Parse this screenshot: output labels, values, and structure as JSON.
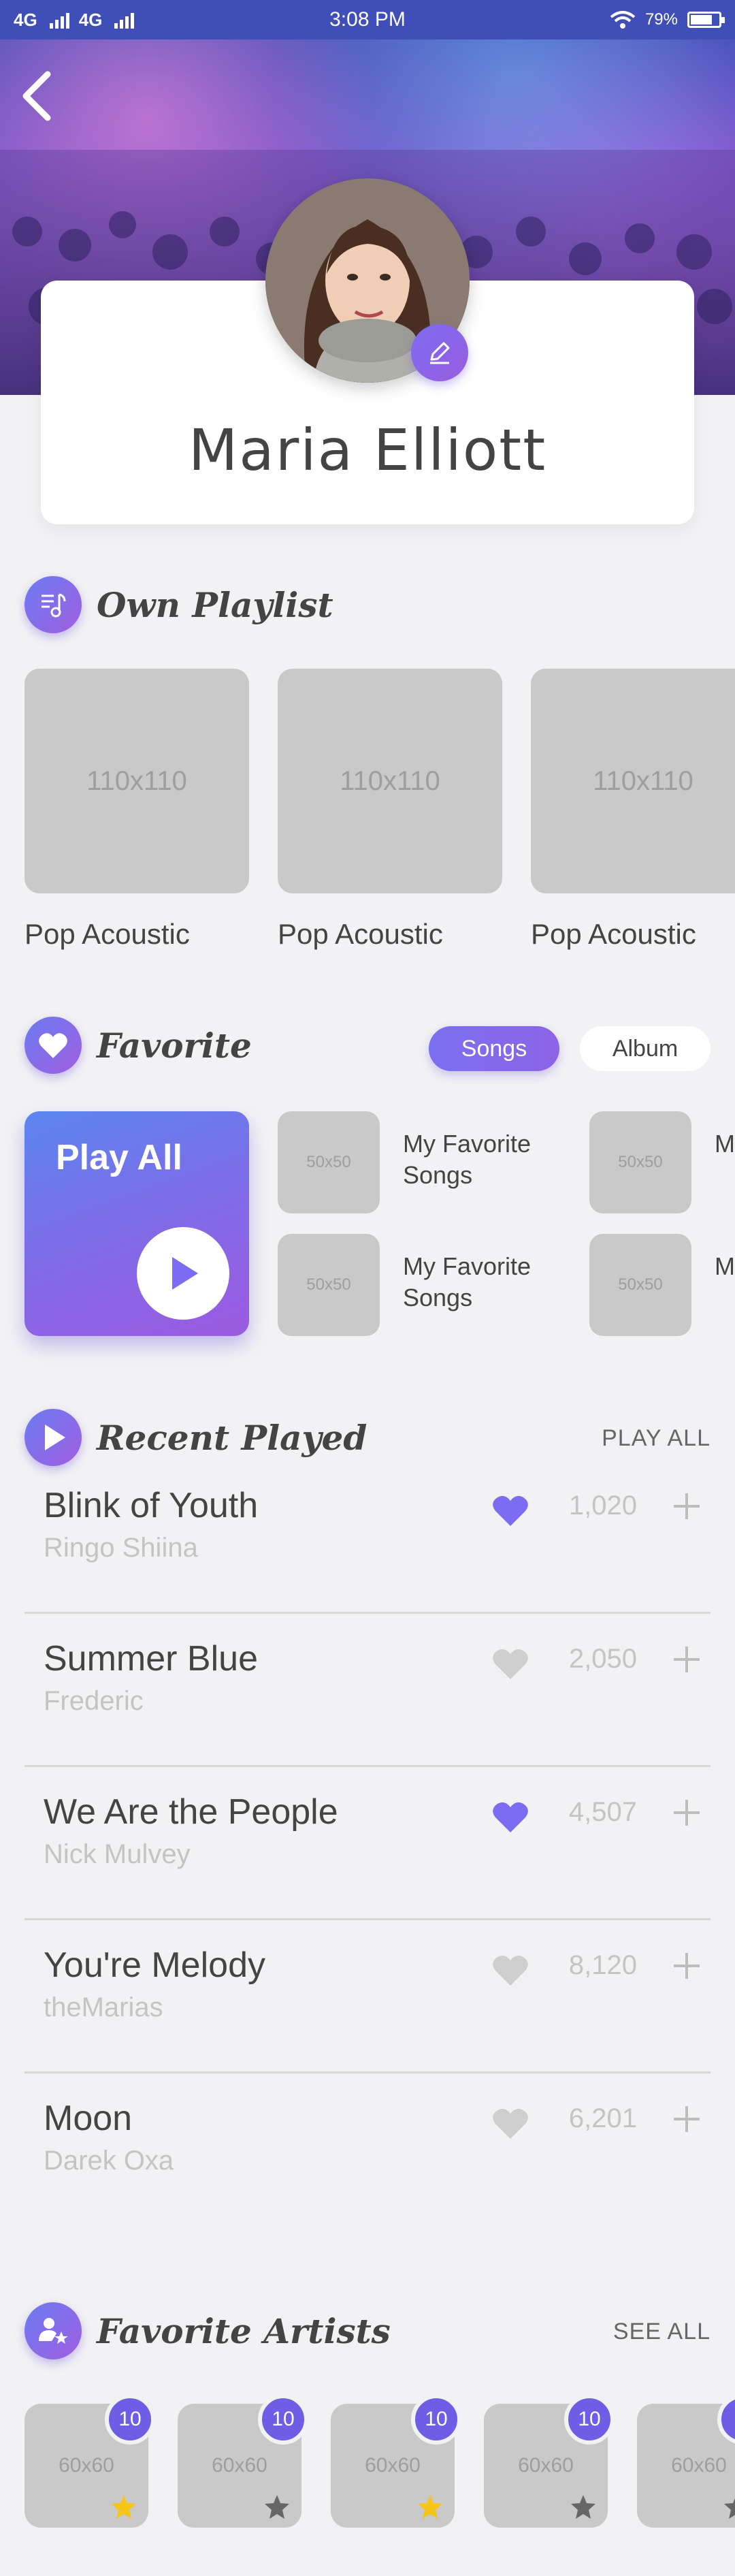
{
  "status_bar": {
    "network_1": "4G",
    "network_2": "4G",
    "time": "3:08 PM",
    "battery": "79%",
    "battery_fraction": 0.79
  },
  "profile": {
    "name": "Maria Elliott"
  },
  "own_playlist": {
    "title": "Own Playlist",
    "items": [
      {
        "placeholder": "110x110",
        "label": "Pop Acoustic"
      },
      {
        "placeholder": "110x110",
        "label": "Pop Acoustic"
      },
      {
        "placeholder": "110x110",
        "label": "Pop Acoustic"
      }
    ]
  },
  "favorite": {
    "title": "Favorite",
    "tabs": {
      "songs": "Songs",
      "album": "Album"
    },
    "play_all": "Play All",
    "songs": [
      {
        "placeholder": "50x50",
        "label": "My Favorite Songs"
      },
      {
        "placeholder": "50x50",
        "label": "My Favorite Songs"
      },
      {
        "placeholder": "50x50",
        "label": "My Favorite Songs"
      },
      {
        "placeholder": "50x50",
        "label": "My Favorite Songs"
      }
    ]
  },
  "recent_played": {
    "title": "Recent Played",
    "action": "PLAY ALL",
    "tracks": [
      {
        "title": "Blink of Youth",
        "artist": "Ringo Shiina",
        "count": "1,020",
        "liked": true
      },
      {
        "title": "Summer Blue",
        "artist": "Frederic",
        "count": "2,050",
        "liked": false
      },
      {
        "title": "We Are the People",
        "artist": "Nick Mulvey",
        "count": "4,507",
        "liked": true
      },
      {
        "title": "You're Melody",
        "artist": "theMarias",
        "count": "8,120",
        "liked": false
      },
      {
        "title": "Moon",
        "artist": "Darek Oxa",
        "count": "6,201",
        "liked": false
      }
    ]
  },
  "favorite_artists": {
    "title": "Favorite Artists",
    "action": "SEE ALL",
    "artists": [
      {
        "placeholder": "60x60",
        "badge": "10",
        "star_color": "#f5c518"
      },
      {
        "placeholder": "60x60",
        "badge": "10",
        "star_color": "#666666"
      },
      {
        "placeholder": "60x60",
        "badge": "10",
        "star_color": "#f5c518"
      },
      {
        "placeholder": "60x60",
        "badge": "10",
        "star_color": "#666666"
      },
      {
        "placeholder": "60x60",
        "badge": "",
        "star_color": "#666666"
      }
    ]
  },
  "colors": {
    "accent": "#7b6cf2",
    "accent_purple": "#9a5ddf",
    "heart_liked": "#7b6cf2",
    "heart_unliked": "#cfcfcf"
  }
}
